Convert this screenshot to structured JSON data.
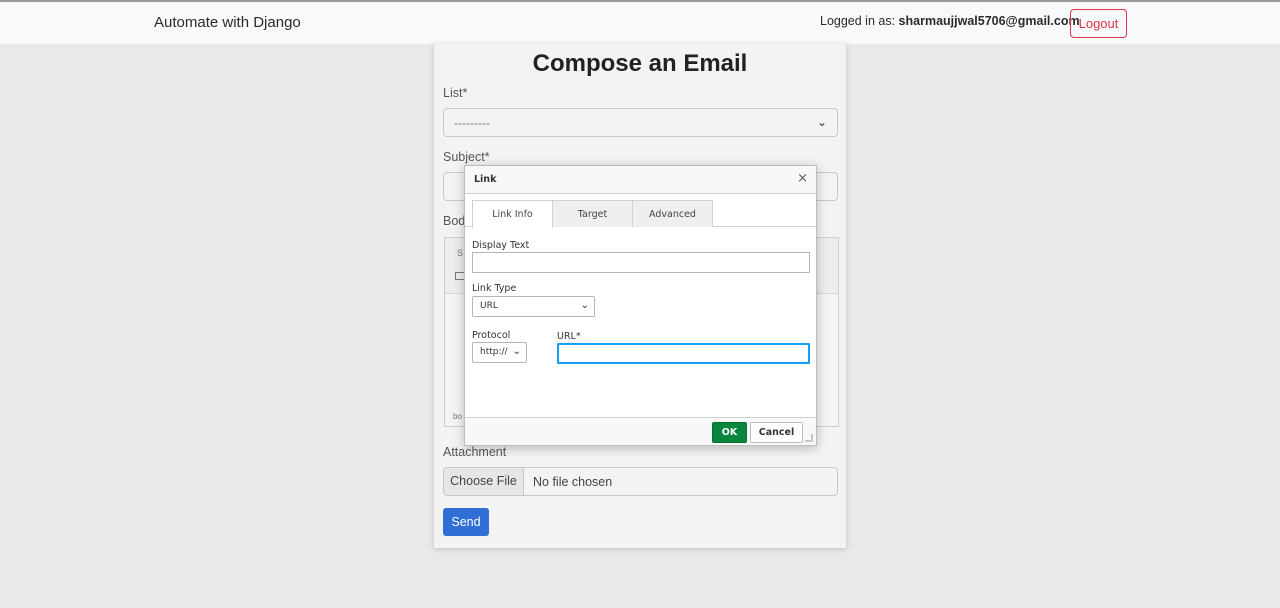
{
  "navbar": {
    "brand": "Automate with Django",
    "logged_in_label": "Logged in as:",
    "user_email": "sharmaujjwal5706@gmail.com",
    "logout_label": "Logout"
  },
  "form": {
    "title": "Compose an Email",
    "list_label": "List*",
    "list_value": "---------",
    "subject_label": "Subject*",
    "body_label": "Bod",
    "editor_path": "bo",
    "attachment_label": "Attachment",
    "choose_file_label": "Choose File",
    "file_status": "No file chosen",
    "send_label": "Send"
  },
  "dialog": {
    "title": "Link",
    "tabs": [
      {
        "label": "Link Info",
        "active": true
      },
      {
        "label": "Target",
        "active": false
      },
      {
        "label": "Advanced",
        "active": false
      }
    ],
    "display_text_label": "Display Text",
    "display_text_value": "",
    "link_type_label": "Link Type",
    "link_type_value": "URL",
    "protocol_label": "Protocol",
    "protocol_value": "http://",
    "url_label": "URL*",
    "url_value": "",
    "ok_label": "OK",
    "cancel_label": "Cancel"
  },
  "colors": {
    "logout": "#dc3545",
    "send": "#2f6fd6",
    "ok": "#09863e",
    "focus": "#139ff7"
  }
}
